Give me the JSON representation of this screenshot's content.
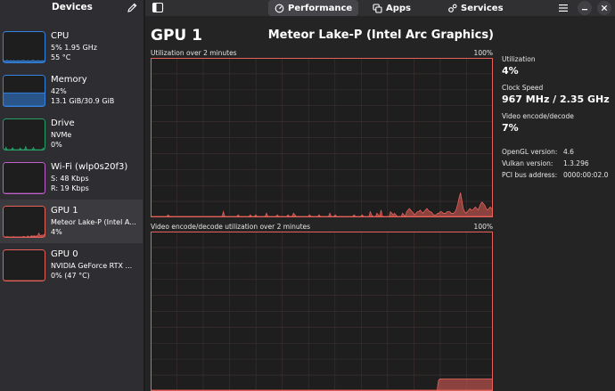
{
  "sidebar": {
    "title": "Devices",
    "devices": [
      {
        "name": "CPU",
        "line1": "5% 1.95 GHz",
        "line2": "55 °C",
        "color": "#3584e4"
      },
      {
        "name": "Memory",
        "line1": "42%",
        "line2": "13.1 GiB/30.9 GiB",
        "color": "#3584e4"
      },
      {
        "name": "Drive",
        "line1": "NVMe",
        "line2": "0%",
        "color": "#26a269"
      },
      {
        "name": "Wi-Fi (wlp0s20f3)",
        "line1": "S: 48 Kbps",
        "line2": "R: 19 Kbps",
        "color": "#c061cb"
      },
      {
        "name": "GPU 1",
        "line1": "Meteor Lake-P (Intel A...",
        "line2": "4%",
        "color": "#e66159"
      },
      {
        "name": "GPU 0",
        "line1": "NVIDIA GeForce RTX ...",
        "line2": "0% (47 °C)",
        "color": "#e66159"
      }
    ]
  },
  "header": {
    "tabs": [
      {
        "label": "Performance",
        "active": true
      },
      {
        "label": "Apps",
        "active": false
      },
      {
        "label": "Services",
        "active": false
      }
    ]
  },
  "main": {
    "title": "GPU 1",
    "model": "Meteor Lake-P (Intel Arc Graphics)",
    "graph1": {
      "label": "Utilization over 2 minutes",
      "max_label": "100%",
      "values": [
        0,
        0,
        0,
        0,
        0,
        0,
        0,
        0,
        0,
        0,
        0,
        0,
        0,
        1,
        0,
        0,
        0,
        0,
        0,
        0,
        0,
        0,
        0,
        0,
        0,
        0,
        0,
        0,
        0,
        0,
        0,
        0,
        0,
        0,
        0,
        0,
        0,
        0,
        0,
        0,
        0,
        0,
        0,
        0,
        0,
        0,
        0,
        0,
        0,
        0,
        0,
        0,
        0,
        0,
        3,
        0,
        0,
        0,
        0,
        0,
        0,
        0,
        0,
        0,
        0,
        1,
        0,
        0,
        0,
        0,
        0,
        0,
        0,
        0,
        1,
        0,
        0,
        0,
        1,
        0,
        0,
        0,
        0,
        0,
        0,
        0,
        2,
        0,
        0,
        0,
        0,
        0,
        0,
        0,
        1,
        0,
        0,
        0,
        0,
        0,
        0,
        0,
        1,
        0,
        0,
        0,
        2,
        1,
        0,
        0,
        0,
        0,
        0,
        0,
        0,
        0,
        0,
        0,
        1,
        0,
        0,
        0,
        0,
        0,
        0,
        1,
        0,
        0,
        0,
        0,
        0,
        0,
        0,
        2,
        0,
        0,
        0,
        1,
        0,
        0,
        0,
        0,
        0,
        0,
        0,
        0,
        0,
        0,
        0,
        0,
        0,
        1,
        0,
        0,
        0,
        0,
        0,
        1,
        0,
        0,
        0,
        0,
        0,
        3,
        1,
        0,
        0,
        0,
        2,
        1,
        0,
        4,
        0,
        0,
        0,
        0,
        0,
        0,
        3,
        2,
        1,
        2,
        1,
        0,
        0,
        0,
        0,
        2,
        1,
        0,
        3,
        4,
        5,
        4,
        3,
        2,
        1,
        2,
        3,
        3,
        4,
        3,
        2,
        3,
        4,
        5,
        4,
        3,
        3,
        2,
        1,
        1,
        1,
        2,
        2,
        3,
        3,
        2,
        2,
        2,
        3,
        3,
        3,
        2,
        2,
        2,
        3,
        5,
        8,
        12,
        15,
        10,
        5,
        3,
        2,
        3,
        4,
        5,
        4,
        4,
        5,
        6,
        5,
        4,
        6,
        8,
        9,
        8,
        7,
        5,
        4,
        5,
        6,
        5,
        5
      ]
    },
    "graph2": {
      "label": "Video encode/decode utilization over 2 minutes",
      "max_label": "100%",
      "values": [
        0,
        0,
        0,
        0,
        0,
        0,
        0,
        0,
        0,
        0,
        0,
        0,
        0,
        0,
        0,
        0,
        0,
        0,
        0,
        0,
        0,
        0,
        0,
        0,
        0,
        0,
        0,
        0,
        0,
        0,
        0,
        0,
        0,
        0,
        0,
        0,
        0,
        0,
        0,
        0,
        0,
        0,
        0,
        0,
        0,
        0,
        0,
        0,
        0,
        0,
        0,
        0,
        0,
        0,
        0,
        0,
        0,
        0,
        0,
        0,
        0,
        0,
        0,
        0,
        0,
        0,
        0,
        0,
        0,
        0,
        0,
        0,
        0,
        0,
        0,
        0,
        0,
        0,
        0,
        0,
        0,
        0,
        0,
        0,
        0,
        0,
        0,
        0,
        0,
        0,
        0,
        0,
        0,
        0,
        0,
        0,
        0,
        0,
        0,
        0,
        0,
        0,
        0,
        0,
        0,
        0,
        0,
        0,
        0,
        0,
        0,
        0,
        0,
        0,
        0,
        0,
        0,
        0,
        0,
        0,
        0,
        0,
        0,
        0,
        0,
        0,
        0,
        0,
        0,
        0,
        0,
        0,
        0,
        0,
        0,
        0,
        0,
        0,
        0,
        0,
        0,
        0,
        0,
        0,
        0,
        0,
        0,
        0,
        0,
        0,
        0,
        0,
        0,
        0,
        0,
        0,
        0,
        0,
        0,
        0,
        0,
        0,
        0,
        0,
        0,
        0,
        0,
        0,
        0,
        0,
        0,
        0,
        0,
        0,
        0,
        0,
        0,
        0,
        0,
        0,
        0,
        0,
        0,
        0,
        0,
        0,
        0,
        0,
        0,
        0,
        0,
        0,
        0,
        0,
        0,
        0,
        0,
        0,
        0,
        0,
        0,
        0,
        0,
        0,
        0,
        0,
        0,
        0,
        0,
        0,
        0,
        0,
        0,
        0,
        0,
        0,
        0,
        0,
        0,
        0,
        0,
        0,
        6,
        7,
        7,
        7,
        7,
        7,
        7,
        7,
        7,
        7,
        7,
        7,
        7,
        7,
        7,
        7,
        7,
        7,
        7,
        7,
        7,
        7,
        7,
        7,
        7,
        7,
        7,
        7,
        7,
        7,
        7,
        7,
        7,
        7,
        7,
        7,
        7,
        7,
        7,
        7,
        7,
        7,
        7
      ]
    },
    "stats": {
      "utilization_label": "Utilization",
      "utilization_value": "4%",
      "clock_label": "Clock Speed",
      "clock_value": "967 MHz / 2.35 GHz",
      "video_label": "Video encode/decode",
      "video_value": "7%",
      "opengl_label": "OpenGL version:",
      "opengl_value": "4.6",
      "vulkan_label": "Vulkan version:",
      "vulkan_value": "1.3.296",
      "pci_label": "PCI bus address:",
      "pci_value": "0000:00:02.0"
    }
  },
  "thumbs": {
    "cpu": [
      5,
      6,
      4,
      5,
      7,
      5,
      4,
      6,
      5,
      5,
      6,
      4,
      5,
      5,
      6,
      5,
      4,
      6,
      5,
      7,
      5,
      4,
      5,
      6,
      5,
      4,
      5,
      6,
      7,
      5,
      4,
      5,
      6,
      5,
      5,
      4,
      6,
      5,
      5,
      6
    ],
    "memory": [
      42,
      42,
      42,
      42,
      42,
      42,
      42,
      42,
      42,
      42,
      42,
      42,
      42,
      42,
      42,
      42,
      42,
      42,
      42,
      42
    ],
    "drive": [
      0,
      0,
      0,
      8,
      0,
      0,
      0,
      0,
      0,
      6,
      0,
      0,
      0,
      0,
      0,
      0,
      5,
      0,
      0,
      0,
      0,
      10,
      0,
      0,
      0,
      0,
      0,
      0,
      7,
      0,
      0,
      0,
      0,
      0,
      0,
      0,
      0,
      5,
      0,
      0
    ],
    "wifi": [
      0,
      0,
      0,
      0,
      0,
      0,
      0,
      0,
      0,
      0,
      0,
      0,
      0,
      0,
      0,
      0,
      0,
      0,
      0,
      0
    ],
    "gpu1": [
      0,
      0,
      0,
      0,
      1,
      0,
      0,
      0,
      0,
      0,
      1,
      0,
      0,
      0,
      0,
      0,
      0,
      0,
      0,
      2,
      0,
      0,
      0,
      3,
      0,
      0,
      4,
      2,
      3,
      3,
      2,
      3,
      5,
      12,
      4,
      5,
      6,
      5,
      8,
      6
    ],
    "gpu0": [
      0,
      0,
      0,
      0,
      0,
      0,
      0,
      0,
      0,
      0,
      0,
      0,
      0,
      0,
      0,
      0,
      0,
      0,
      0,
      0
    ]
  }
}
